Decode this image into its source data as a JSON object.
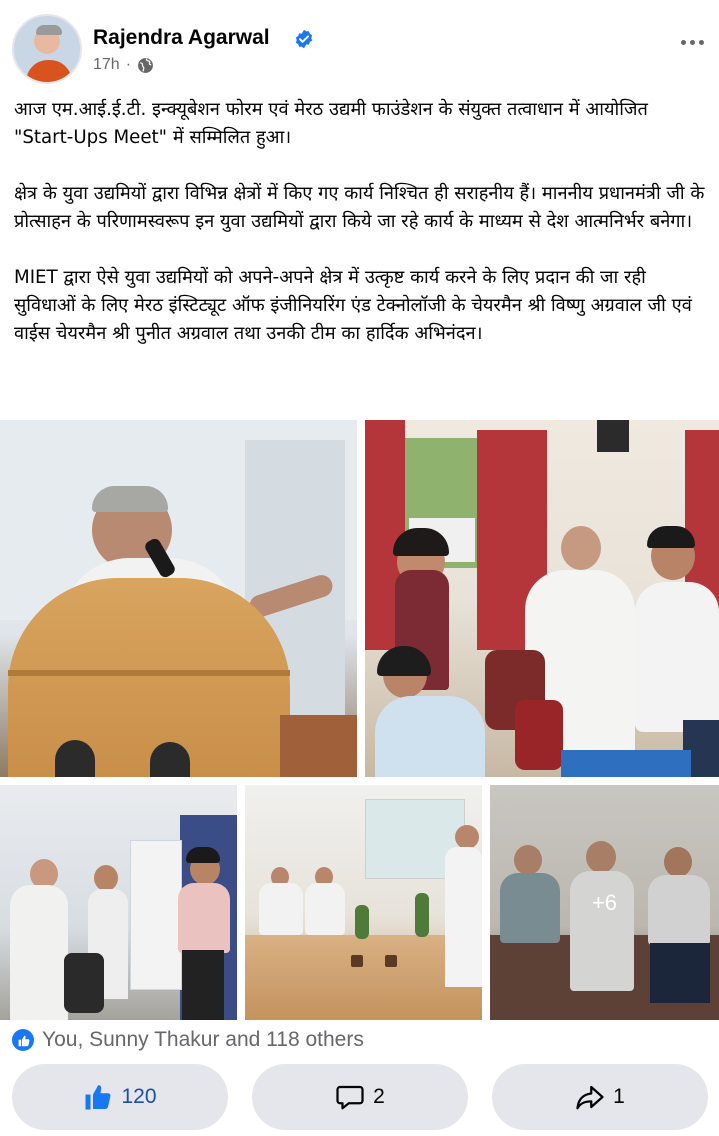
{
  "post": {
    "author": "Rajendra Agarwal",
    "time": "17h",
    "separator": "·",
    "paragraphs": [
      "आज एम.आई.ई.टी. इन्क्यूबेशन फोरम एवं मेरठ उद्यमी फाउंडेशन के संयुक्त तत्वाधान में आयोजित \"Start-Ups Meet\" में सम्मिलित हुआ।",
      "क्षेत्र के युवा उद्यमियों द्वारा विभिन्न क्षेत्रों में किए गए कार्य निश्चित ही सराहनीय हैं। माननीय प्रधानमंत्री जी के प्रोत्साहन के परिणामस्वरूप इन युवा उद्यमियों द्वारा किये जा रहे कार्य के माध्यम से देश आत्मनिर्भर बनेगा।",
      "MIET द्वारा ऐसे युवा उद्यमियों को अपने-अपने क्षेत्र में उत्कृष्ट कार्य करने के लिए प्रदान की जा रही सुविधाओं के लिए मेरठ इंस्टिट्यूट ऑफ इंजीनियरिंग एंड टेक्नोलॉजी के चेयरमैन श्री विष्णु अग्रवाल जी एवं वाईस चेयरमैन श्री पुनीत अग्रवाल तथा उनकी टीम का हार्दिक अभिनंदन।"
    ],
    "more_photos_label": "+6"
  },
  "reactions": {
    "summary": "You, Sunny Thakur and 118 others",
    "like_count": "120",
    "comment_count": "2",
    "share_count": "1"
  },
  "colors": {
    "accent": "#1877f2",
    "secondary_text": "#65676b",
    "button_bg": "#e4e6eb"
  },
  "icons": [
    "verified-badge-icon",
    "globe-icon",
    "more-options-icon",
    "like-reaction-icon",
    "thumbs-up-icon",
    "comment-icon",
    "share-icon"
  ]
}
